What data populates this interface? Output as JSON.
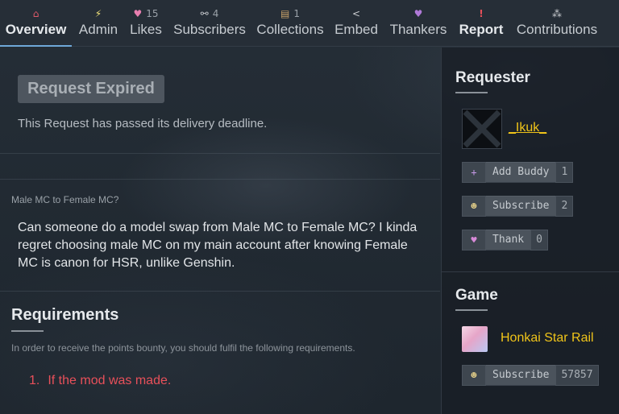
{
  "nav": {
    "items": [
      {
        "icon": "home-icon",
        "glyph": "⌂",
        "count": "",
        "label": "Overview",
        "active": true
      },
      {
        "icon": "lightning-icon",
        "glyph": "⚡",
        "count": "",
        "label": "Admin"
      },
      {
        "icon": "heart-icon",
        "glyph": "♥",
        "count": "15",
        "label": "Likes"
      },
      {
        "icon": "link-icon",
        "glyph": "⚯",
        "count": "4",
        "label": "Subscribers"
      },
      {
        "icon": "collection-box-icon",
        "glyph": "▤",
        "count": "1",
        "label": "Collections"
      },
      {
        "icon": "share-icon",
        "glyph": "<",
        "count": "",
        "label": "Embed"
      },
      {
        "icon": "heart-gift-icon",
        "glyph": "♥",
        "count": "",
        "label": "Thankers"
      },
      {
        "icon": "alert-icon",
        "glyph": "!",
        "count": "",
        "label": "Report"
      },
      {
        "icon": "contributions-icon",
        "glyph": "⁂",
        "count": "",
        "label": "Contributions"
      }
    ]
  },
  "status": {
    "badge": "Request Expired",
    "message": "This Request has passed its delivery deadline."
  },
  "request": {
    "title": "Male MC to Female MC?",
    "body": "Can someone do a model swap from Male MC to Female MC? I kinda regret choosing male MC on my main account after knowing Female MC is canon for HSR, unlike Genshin."
  },
  "requirements": {
    "heading": "Requirements",
    "intro": "In order to receive the points bounty, you should fulfil the following requirements.",
    "items": [
      {
        "number": "1.",
        "text": "If the mod was made."
      }
    ]
  },
  "requester": {
    "heading": "Requester",
    "username": "_Ikuk_",
    "buttons": [
      {
        "icon": "add-buddy-icon",
        "glyph": "+",
        "label": "Add Buddy",
        "count": "1"
      },
      {
        "icon": "subscribe-icon",
        "glyph": "☻",
        "label": "Subscribe",
        "count": "2"
      },
      {
        "icon": "thank-heart-icon",
        "glyph": "♥",
        "label": "Thank",
        "count": "0"
      }
    ]
  },
  "game": {
    "heading": "Game",
    "name": "Honkai Star Rail",
    "subscribe_label": "Subscribe",
    "subscribe_count": "57857",
    "subscribe_glyph": "☻"
  },
  "colors": {
    "accent_yellow": "#f0c419",
    "requirement_red": "#e8505a",
    "active_tab": "#6fa8d8"
  }
}
